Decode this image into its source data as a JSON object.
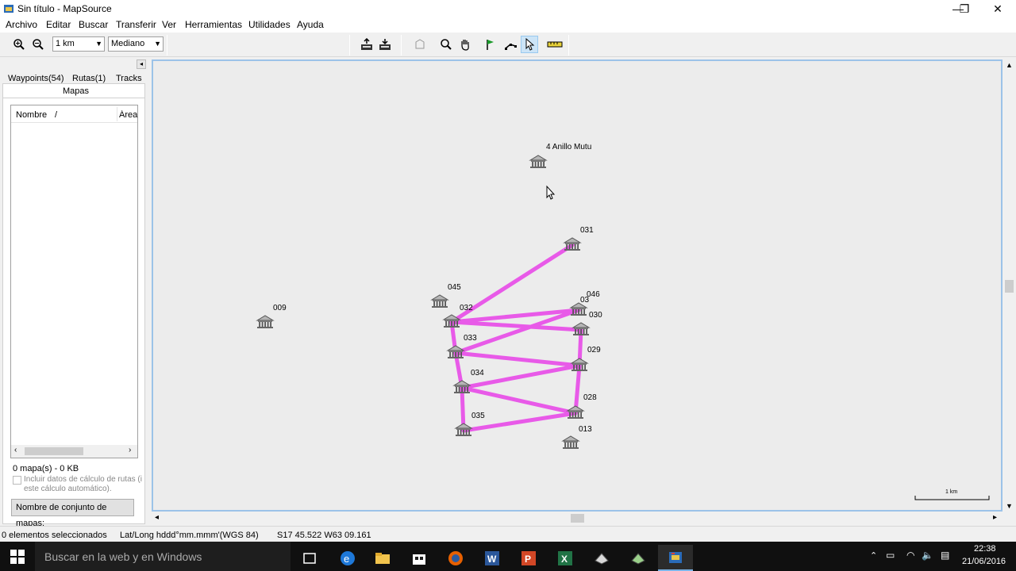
{
  "window": {
    "title": "Sin título - MapSource",
    "controls": {
      "minimize": "—",
      "restore": "❐",
      "close": "✕"
    }
  },
  "menu": [
    "Archivo",
    "Editar",
    "Buscar",
    "Transferir",
    "Ver",
    "Herramientas",
    "Utilidades",
    "Ayuda"
  ],
  "toolbar": {
    "zoom_scale": "1 km",
    "detail_level": "Mediano"
  },
  "left_panel": {
    "tabs": [
      "Waypoints(54)",
      "Rutas(1)",
      "Tracks",
      "Mapas"
    ],
    "list_columns": [
      "Nombre",
      "/",
      "Área"
    ],
    "maps_summary": "0 mapa(s) - 0 KB",
    "include_route_data_line1": "Incluir datos de cálculo de rutas (i",
    "include_route_data_line2": "este cálculo automático).",
    "mapset_name_button": "Nombre de conjunto de mapas:"
  },
  "map": {
    "background": "#ececec",
    "route_color": "#e85ae8",
    "scale_label": "1 km",
    "waypoints": [
      {
        "name": "4 Anillo Mutu"
      },
      {
        "name": "031"
      },
      {
        "name": "045"
      },
      {
        "name": "046"
      },
      {
        "name": "032"
      },
      {
        "name": "030"
      },
      {
        "name": "009"
      },
      {
        "name": "033"
      },
      {
        "name": "029"
      },
      {
        "name": "034"
      },
      {
        "name": "028"
      },
      {
        "name": "035"
      },
      {
        "name": "013"
      }
    ],
    "route_order": [
      "031",
      "032",
      "046",
      "033",
      "029",
      "034",
      "028",
      "035",
      "034",
      "033",
      "032",
      "030",
      "029",
      "028"
    ]
  },
  "status": {
    "selected": "0 elementos seleccionados",
    "format": "Lat/Long hddd°mm.mmm'(WGS 84)",
    "coords": "S17 45.522 W63 09.161"
  },
  "taskbar": {
    "search_placeholder": "Buscar en la web y en Windows",
    "time": "22:38",
    "date": "21/06/2016"
  }
}
